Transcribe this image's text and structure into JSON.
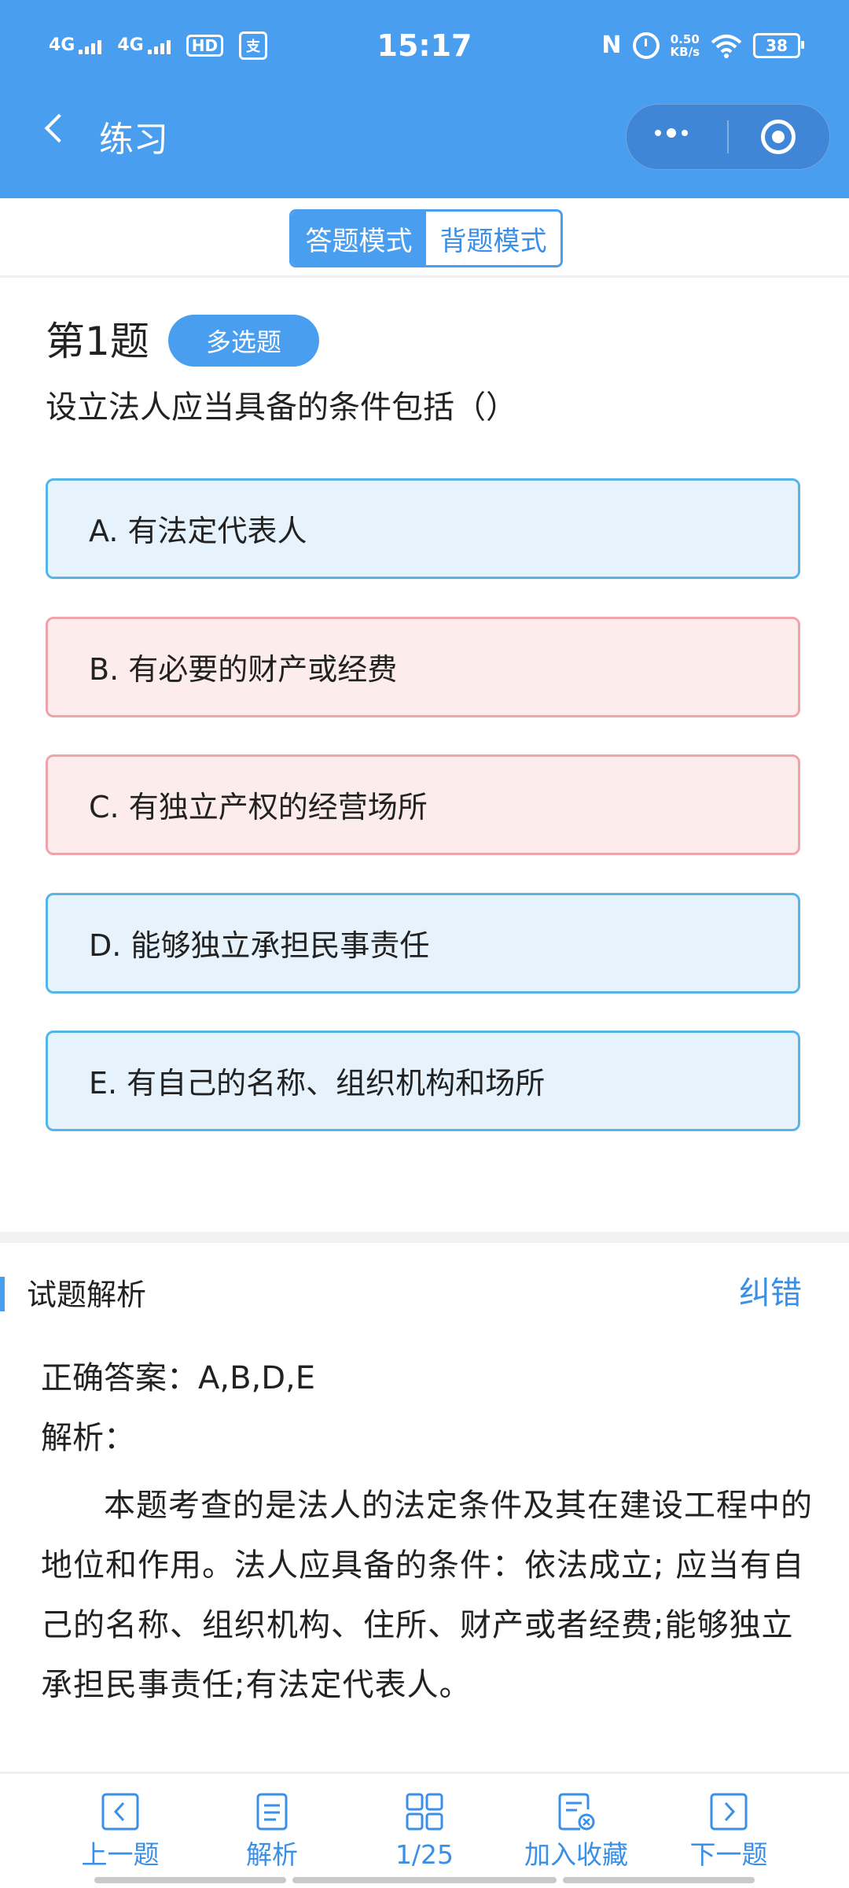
{
  "status_bar": {
    "time": "15:17",
    "signal1": "4G",
    "signal2": "4G",
    "hd": "HD",
    "speed_value": "0.50",
    "speed_unit": "KB/s",
    "battery": "38"
  },
  "header": {
    "title": "练习"
  },
  "modes": [
    {
      "label": "答题模式",
      "active": true
    },
    {
      "label": "背题模式",
      "active": false
    }
  ],
  "question": {
    "number": "第1题",
    "type": "多选题",
    "stem": "设立法人应当具备的条件包括（）",
    "options": [
      {
        "text": "A. 有法定代表人",
        "state": "correct"
      },
      {
        "text": "B. 有必要的财产或经费",
        "state": "wrong"
      },
      {
        "text": "C. 有独立产权的经营场所",
        "state": "wrong"
      },
      {
        "text": "D. 能够独立承担民事责任",
        "state": "correct"
      },
      {
        "text": "E. 有自己的名称、组织机构和场所",
        "state": "correct"
      }
    ]
  },
  "analysis": {
    "title": "试题解析",
    "report": "纠错",
    "answer": "正确答案：A,B,D,E",
    "label": "解析：",
    "text": "本题考查的是法人的法定条件及其在建设工程中的地位和作用。法人应具备的条件：依法成立; 应当有自己的名称、组织机构、住所、财产或者经费;能够独立承担民事责任;有法定代表人。"
  },
  "bottom_nav": [
    {
      "label": "上一题",
      "icon": "chevron-left-icon"
    },
    {
      "label": "解析",
      "icon": "document-icon"
    },
    {
      "label": "1/25",
      "icon": "grid-icon"
    },
    {
      "label": "加入收藏",
      "icon": "favorite-list-icon"
    },
    {
      "label": "下一题",
      "icon": "chevron-right-icon"
    }
  ],
  "colors": {
    "primary": "#4a9ef0",
    "correct_bg": "#e7f3fc",
    "correct_border": "#55b4e8",
    "wrong_bg": "#fdecec",
    "wrong_border": "#f0a3a8"
  }
}
